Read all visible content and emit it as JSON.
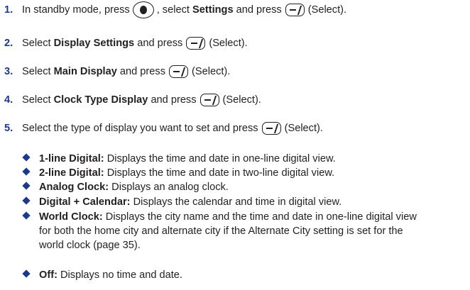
{
  "steps": [
    {
      "num": "1.",
      "t1": "In standby mode, press",
      "t2": ", select",
      "b1": "Settings",
      "t3": "and press",
      "t4": "(Select)."
    },
    {
      "num": "2.",
      "t1": "Select",
      "b1": "Display Settings",
      "t2": "and press",
      "t3": "(Select)."
    },
    {
      "num": "3.",
      "t1": "Select",
      "b1": "Main Display",
      "t2": "and press",
      "t3": "(Select)."
    },
    {
      "num": "4.",
      "t1": "Select",
      "b1": "Clock Type Display",
      "t2": "and press",
      "t3": "(Select)."
    },
    {
      "num": "5.",
      "t1": "Select the type of display you want to set and press",
      "t2": "(Select)."
    }
  ],
  "options": [
    {
      "label": "1-line Digital:",
      "desc": "Displays the time and date in one-line digital view."
    },
    {
      "label": "2-line Digital:",
      "desc": "Displays the time and date in two-line digital view."
    },
    {
      "label": "Analog Clock:",
      "desc": "Displays an analog clock."
    },
    {
      "label": "Digital + Calendar:",
      "desc": "Displays the calendar and time in digital view."
    },
    {
      "label": "World Clock:",
      "desc": "Displays the city name and the time and date in one-line digital view for both the home city and alternate city if the Alternate City setting is set for the world clock (page 35)."
    },
    {
      "label": "Off:",
      "desc": "Displays no time and date."
    }
  ],
  "colors": {
    "accent": "#1d3a8a",
    "text": "#231f20"
  }
}
